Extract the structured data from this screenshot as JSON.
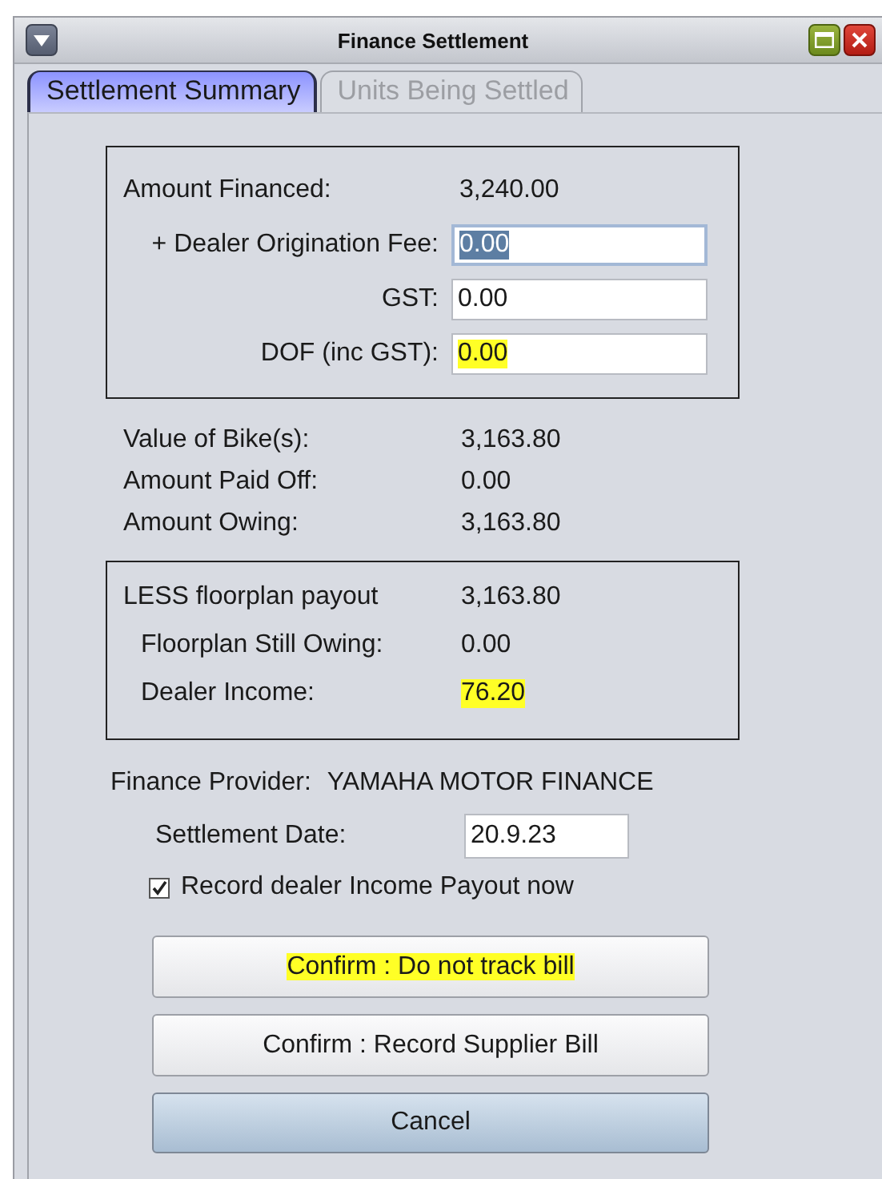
{
  "window": {
    "title": "Finance Settlement"
  },
  "tabs": [
    {
      "label": "Settlement Summary",
      "selected": true
    },
    {
      "label": "Units Being Settled",
      "selected": false
    }
  ],
  "financing_box": [
    {
      "kind": "text",
      "label": "Amount Financed:",
      "value": "3,240.00"
    },
    {
      "kind": "field",
      "label": "+ Dealer Origination Fee:",
      "value": "0.00",
      "selected": true,
      "highlighted": false
    },
    {
      "kind": "field",
      "label": "GST:",
      "value": "0.00",
      "selected": false,
      "highlighted": false
    },
    {
      "kind": "field",
      "label": "DOF (inc GST):",
      "value": "0.00",
      "selected": false,
      "highlighted": true
    }
  ],
  "totals": [
    {
      "label": "Value of Bike(s):",
      "value": "3,163.80"
    },
    {
      "label": "Amount Paid Off:",
      "value": "0.00"
    },
    {
      "label": "Amount Owing:",
      "value": "3,163.80"
    }
  ],
  "floorplan_box": [
    {
      "label": "LESS floorplan payout",
      "value": "3,163.80",
      "indented": false,
      "highlighted": false
    },
    {
      "label": "Floorplan Still Owing:",
      "value": "0.00",
      "indented": true,
      "highlighted": false
    },
    {
      "label": "Dealer Income:",
      "value": "76.20",
      "indented": true,
      "highlighted": true
    }
  ],
  "finance_provider": {
    "label": "Finance Provider:",
    "value": "YAMAHA MOTOR FINANCE"
  },
  "settlement_date": {
    "label": "Settlement Date:",
    "value": "20.9.23"
  },
  "record_payout": {
    "label": "Record dealer Income Payout now",
    "checked": true
  },
  "buttons": [
    {
      "label": "Confirm : Do not track bill",
      "kind": "plain",
      "highlighted": true
    },
    {
      "label": "Confirm : Record Supplier Bill",
      "kind": "plain",
      "highlighted": false
    },
    {
      "label": "Cancel",
      "kind": "default",
      "highlighted": false
    }
  ]
}
